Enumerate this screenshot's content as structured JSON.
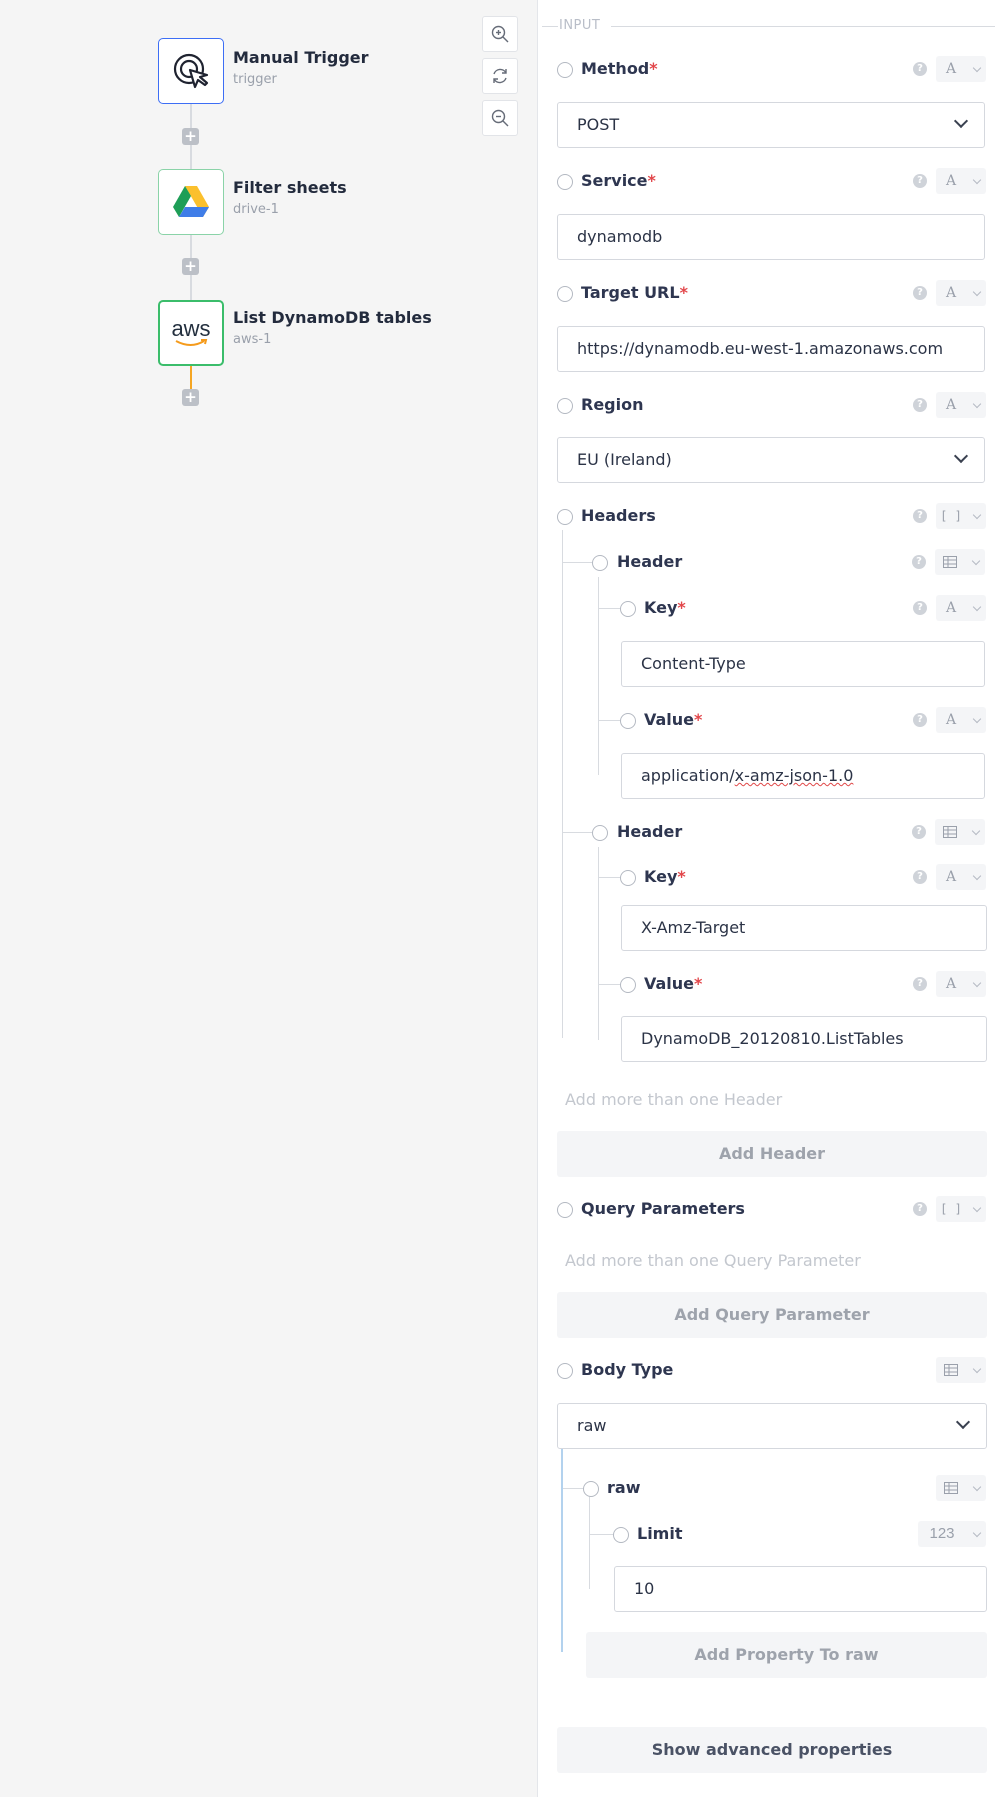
{
  "canvas": {
    "nodes": [
      {
        "title": "Manual Trigger",
        "subtitle": "trigger",
        "icon": "cursor-click-icon",
        "border": "#3d6ef5"
      },
      {
        "title": "Filter sheets",
        "subtitle": "drive-1",
        "icon": "google-drive-icon",
        "border": "#5ac48a"
      },
      {
        "title": "List DynamoDB tables",
        "subtitle": "aws-1",
        "icon": "aws-logo-icon",
        "border": "#3bbd6b",
        "logo_text": "aws"
      }
    ],
    "add_step_symbol": "+",
    "zoom_controls": [
      "zoom-in-icon",
      "refresh-icon",
      "zoom-out-icon"
    ],
    "active_connector_color": "#f5a623"
  },
  "panel": {
    "section_label": "INPUT",
    "method": {
      "label": "Method",
      "type": "A",
      "value": "POST"
    },
    "service": {
      "label": "Service",
      "type": "A",
      "value": "dynamodb"
    },
    "target_url": {
      "label": "Target URL",
      "type": "A",
      "value": "https://dynamodb.eu-west-1.amazonaws.com"
    },
    "region": {
      "label": "Region",
      "type": "A",
      "value": "EU (Ireland)"
    },
    "headers": {
      "label": "Headers",
      "type": "[ ]",
      "items": [
        {
          "label": "Header",
          "key_label": "Key",
          "key_value": "Content-Type",
          "value_label": "Value",
          "value_prefix": "application/",
          "value_suffix": "x-amz-json-1.0",
          "type": "A"
        },
        {
          "label": "Header",
          "key_label": "Key",
          "key_value": "X-Amz-Target",
          "value_label": "Value",
          "value_value": "DynamoDB_20120810.ListTables",
          "type": "A"
        }
      ],
      "hint": "Add more than one Header",
      "add_button": "Add Header"
    },
    "query_parameters": {
      "label": "Query Parameters",
      "type": "[ ]",
      "hint": "Add more than one Query Parameter",
      "add_button": "Add Query Parameter"
    },
    "body_type": {
      "label": "Body Type",
      "value": "raw",
      "raw": {
        "label": "raw",
        "limit_label": "Limit",
        "limit_type": "123",
        "limit_value": "10",
        "add_button": "Add Property To raw"
      }
    },
    "advanced_button": "Show advanced properties",
    "required_marker": "*",
    "help_symbol": "?"
  }
}
